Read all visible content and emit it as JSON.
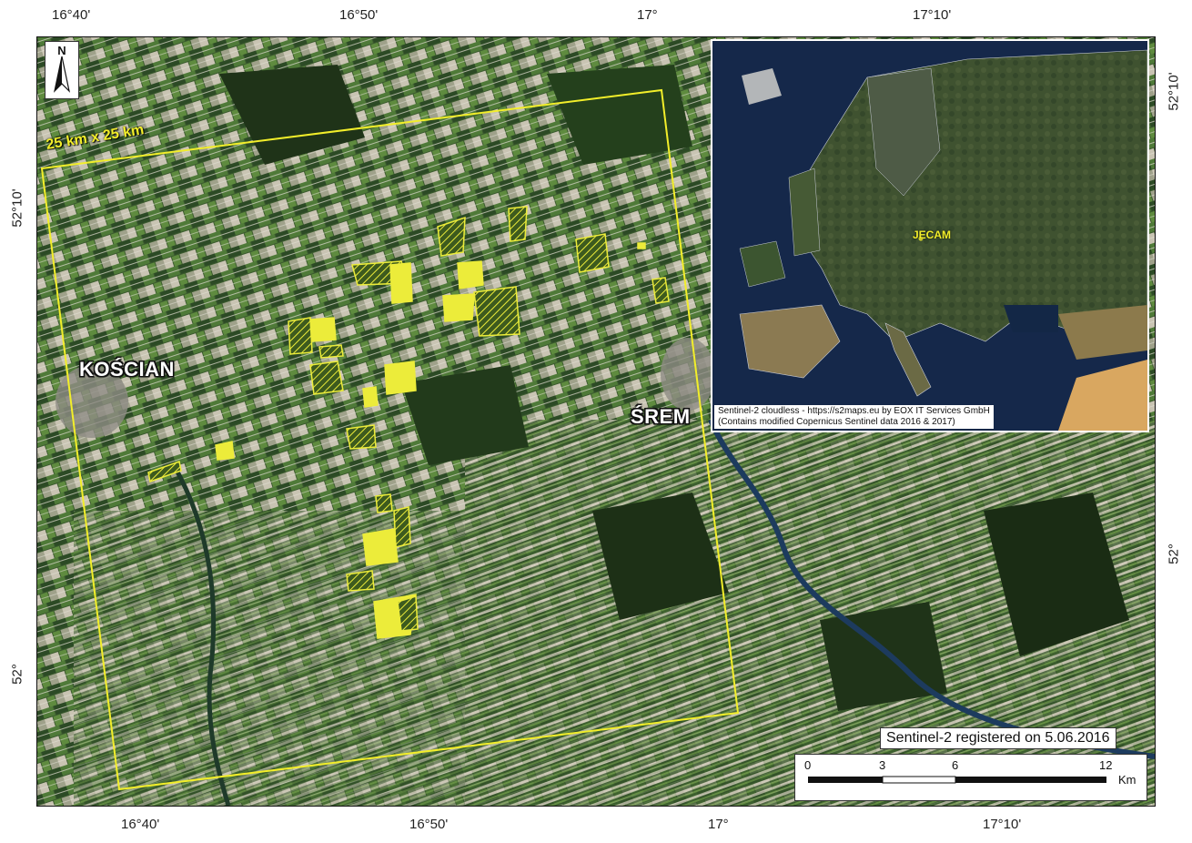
{
  "graticule": {
    "top": [
      "16°40'",
      "16°50'",
      "17°",
      "17°10'"
    ],
    "bottom": [
      "16°40'",
      "16°50'",
      "17°",
      "17°10'"
    ],
    "left": [
      "52°10'",
      "52°"
    ],
    "right": [
      "52°10'",
      "52°"
    ]
  },
  "map": {
    "aoi_label": "25 km x 25 km",
    "cities": {
      "koscian": "KOŚCIAN",
      "srem": "ŚREM"
    },
    "north_letter": "N",
    "date_label": "Sentinel-2 registered on 5.06.2016",
    "colors": {
      "aoi_outline": "#f2ee2a",
      "field_fill": "#ecec3a",
      "vegetation": "#2e4a26",
      "water": "#1d3b5e"
    }
  },
  "inset": {
    "site_label": "JECAM",
    "credit_line1": "Sentinel-2 cloudless - https://s2maps.eu by EOX IT Services GmbH",
    "credit_line2": "(Contains  modified  Copernicus  Sentinel  data  2016  &  2017)"
  },
  "scalebar": {
    "ticks": [
      "0",
      "3",
      "6",
      "12"
    ],
    "unit": "Km"
  }
}
